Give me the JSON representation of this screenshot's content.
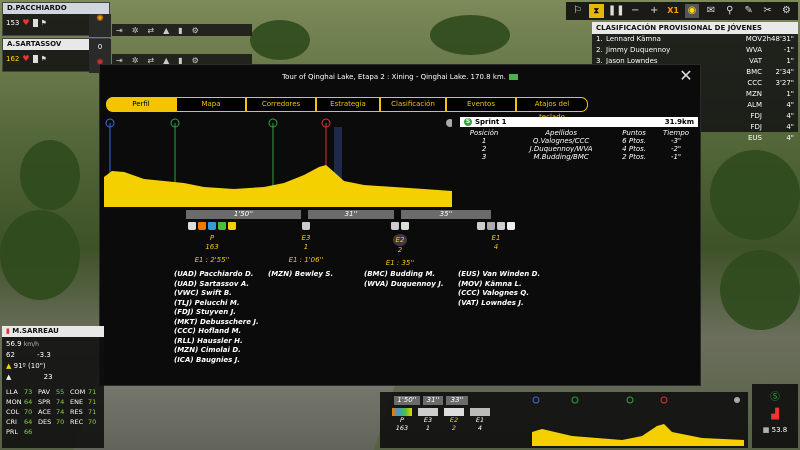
{
  "riders_top": [
    {
      "name": "D.PACCHIARDO",
      "energy": "153",
      "side_value": "",
      "team_value": ""
    },
    {
      "name": "A.SARTASSOV",
      "energy": "162",
      "side_value": "0"
    }
  ],
  "toolbar": {
    "speed": "X1",
    "icons": [
      "pause-icon",
      "minus-icon",
      "plus-icon",
      "hourglass-icon",
      "eye-icon",
      "bike-icon",
      "settings-icon"
    ]
  },
  "standings": {
    "title": "CLASIFICACIÓN PROVISIONAL DE JÓVENES",
    "rows": [
      {
        "pos": "1.",
        "name": "Lennard Kämna",
        "team": "MOV",
        "time": "2h48'31\""
      },
      {
        "pos": "2.",
        "name": "Jimmy Duquennoy",
        "team": "WVA",
        "time": "-1\""
      },
      {
        "pos": "3.",
        "name": "Jason Lowndes",
        "team": "VAT",
        "time": "1\""
      },
      {
        "pos": "",
        "name": "",
        "team": "BMC",
        "time": "2'34\""
      },
      {
        "pos": "",
        "name": "",
        "team": "CCC",
        "time": "3'27\""
      },
      {
        "pos": "",
        "name": "",
        "team": "MZN",
        "time": "1\""
      },
      {
        "pos": "",
        "name": "",
        "team": "ALM",
        "time": "4\""
      },
      {
        "pos": "",
        "name": "",
        "team": "FDJ",
        "time": "4\""
      },
      {
        "pos": "",
        "name": "",
        "team": "FDJ",
        "time": "4\""
      },
      {
        "pos": "",
        "name": "",
        "team": "EUS",
        "time": "4\""
      }
    ]
  },
  "modal": {
    "title": "Tour of Qinghai Lake, Etapa 2 : Xining - Qinghai Lake. 170.8 km.",
    "tabs": [
      "Perfil",
      "Mapa",
      "Corredores",
      "Estrategia",
      "Clasificación",
      "Eventos",
      "Atajos del teclado"
    ],
    "sprint": {
      "name": "Sprint 1",
      "distance": "31.9km",
      "headers": [
        "Posición",
        "Apellidos",
        "Puntos",
        "Tiempo"
      ],
      "rows": [
        [
          "1",
          "Q.Valognes/CCC",
          "6 Ptos.",
          "-3\""
        ],
        [
          "2",
          "J.Duquennoy/WVA",
          "4 Ptos.",
          "-2\""
        ],
        [
          "3",
          "M.Budding/BMC",
          "2 Ptos.",
          "-1\""
        ]
      ]
    },
    "gaps": [
      "1'50''",
      "31''",
      "35''"
    ],
    "groups": [
      {
        "label": "P",
        "count": "163",
        "time": "E1 : 2'55''"
      },
      {
        "label": "E3",
        "count": "1",
        "time": "E1 : 1'06''"
      },
      {
        "label": "E2",
        "count": "2",
        "time": "E1 : 35''"
      },
      {
        "label": "E1",
        "count": "4",
        "time": ""
      }
    ],
    "names_p": [
      "(UAD) Pacchiardo D.",
      "(UAD) Sartassov A.",
      "(VWC) Swift B.",
      "(TLJ) Pelucchi M.",
      "(FDJ) Stuyven J.",
      "(MKT) Debusschere J.",
      "(CCC) Hofland M.",
      "(RLL) Haussler H.",
      "(MZN) Cimolai D.",
      "(ICA) Baugnies J."
    ],
    "names_e3": [
      "(MZN) Bewley S."
    ],
    "names_e2": [
      "(BMC) Budding M.",
      "(WVA) Duquennoy J."
    ],
    "names_e1": [
      "(EUS) Van Winden D.",
      "(MOV) Kämna L.",
      "(CCC) Valognes Q.",
      "(VAT) Lowndes J."
    ]
  },
  "focus_rider": {
    "name": "M.SARREAU",
    "speed": "56.9",
    "speed_unit": "km/h",
    "hr": "62",
    "slope": "-3.3",
    "position": "91º (10\")",
    "gap2": "23",
    "attributes": [
      [
        "LLA",
        "73",
        "PAV",
        "55",
        "COM",
        "71"
      ],
      [
        "MON",
        "64",
        "SPR",
        "74",
        "ENE",
        "71"
      ],
      [
        "COL",
        "70",
        "ACE",
        "74",
        "RES",
        "71"
      ],
      [
        "CRI",
        "64",
        "DES",
        "70",
        "REC",
        "70"
      ],
      [
        "PRL",
        "66",
        "",
        "",
        "",
        ""
      ]
    ]
  },
  "mini": {
    "gaps": [
      "1'50''",
      "31''",
      "33''"
    ],
    "groups": [
      {
        "label": "P",
        "count": "163"
      },
      {
        "label": "E3",
        "count": "1"
      },
      {
        "label": "E2",
        "count": "2"
      },
      {
        "label": "E1",
        "count": "4"
      }
    ],
    "right_value": "53.8"
  }
}
